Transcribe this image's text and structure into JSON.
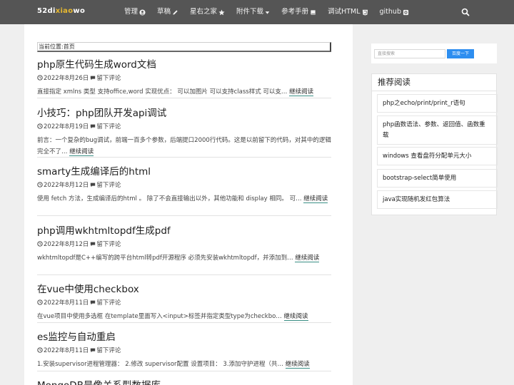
{
  "navbar": {
    "brand_part1": "52di",
    "brand_part2": "xiao",
    "brand_part3": "wo",
    "items": [
      {
        "label": "管理",
        "icon": "user-circle-icon"
      },
      {
        "label": "草稿",
        "icon": "pencil-icon"
      },
      {
        "label": "星右之家",
        "icon": "star-icon"
      },
      {
        "label": "附件下载",
        "icon": "caret-down-icon"
      },
      {
        "label": "参考手册",
        "icon": "book-icon"
      },
      {
        "label": "调试HTML",
        "icon": "html5-icon"
      },
      {
        "label": "github",
        "icon": "github-icon"
      }
    ],
    "search_icon": "search-icon"
  },
  "breadcrumb": {
    "prefix": "当前位置:",
    "home": "首页"
  },
  "articles": [
    {
      "title": "php原生代码生成word文档",
      "date": "2022年8月26日",
      "comment": "留下评论",
      "excerpt": "直接指定 xmlns 类型 支持office,word 实现优点： 可以加图片 可以支持class样式 可以支…",
      "more": "继续阅读"
    },
    {
      "title": "小技巧：php团队开发api调试",
      "date": "2022年8月19日",
      "comment": "留下评论",
      "excerpt": "前言：一个复杂的bug调试，前端一百多个参数，后端提口2000行代码。这是以前留下的代码，对其中的逻辑完全不了…",
      "more": "继续阅读"
    },
    {
      "title": "smarty生成编译后的html",
      "date": "2022年8月12日",
      "comment": "留下评论",
      "excerpt": "使用 fetch 方法，生成编译后的html 。 除了不会直接输出以外，其他功能和 display 相同。 可…",
      "more": "继续阅读"
    },
    {
      "title": "php调用wkhtmltopdf生成pdf",
      "date": "2022年8月12日",
      "comment": "留下评论",
      "excerpt": "wkhtmltopdf是C++编写的跨平台html转pdf开源程序 必须先安装wkhtmltopdf，并添加到…",
      "more": "继续阅读"
    },
    {
      "title": "在vue中使用checkbox",
      "date": "2022年8月11日",
      "comment": "留下评论",
      "excerpt": "在vue项目中使用多选框 在template里面写入<input>标签并指定类型type为checkbo…",
      "more": "继续阅读"
    },
    {
      "title": "es监控与自动重启",
      "date": "2022年8月11日",
      "comment": "留下评论",
      "excerpt": "1.安装supervisor进程管理器： 2.修改 supervisor配置 设置项目： 3.添加守护进程（共…",
      "more": "继续阅读"
    },
    {
      "title": "MongoDB是像关系型数据库",
      "date": "",
      "comment": "",
      "excerpt": "",
      "more": ""
    }
  ],
  "sidebar": {
    "search_placeholder": "直接搜索",
    "search_button": "百度一下",
    "recommend_title": "推荐阅读",
    "recommend": [
      "php之echo/print/print_r语句",
      "php函数语法、参数、返回值、函数重载",
      "windows 查看盘符分配单元大小",
      "bootstrap-select简单使用",
      "java实现随机发红包算法"
    ]
  },
  "colors": {
    "navbar_bg": "#555555",
    "brand_accent": "#e6b830",
    "link_underline": "#3a8f85",
    "button_blue": "#2d8ef0"
  }
}
